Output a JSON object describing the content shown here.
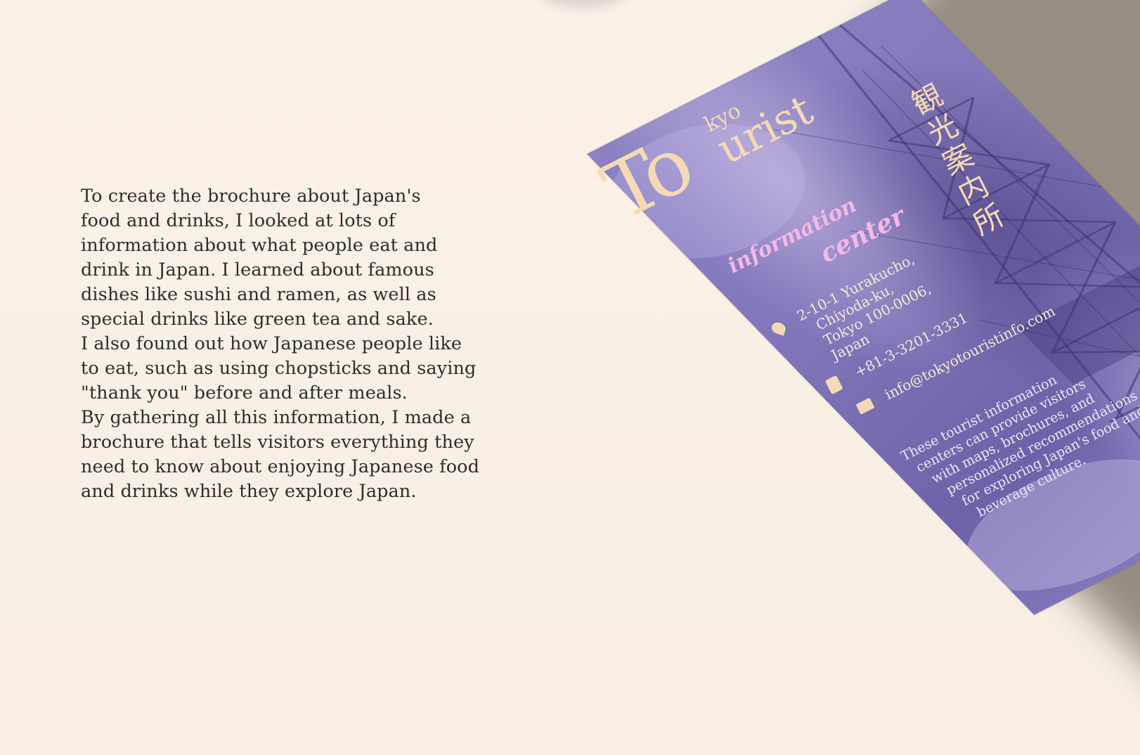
{
  "paragraph": [
    "To create the brochure about Japan's",
    "food and drinks, I looked at lots of",
    "information about what people eat and",
    "drink in Japan. I learned about famous",
    "dishes like sushi and ramen, as well as",
    "special drinks like green tea and sake.",
    "I also found out how Japanese people like",
    "to eat, such as using chopsticks and saying",
    "\"thank you\" before and after meals.",
    "By gathering all this information, I made a",
    "brochure that tells visitors everything they",
    "need to know about enjoying Japanese food",
    "and drinks while they explore Japan."
  ],
  "brochure": {
    "logo_to": "To",
    "logo_kyo": "kyo",
    "logo_urist": "urist",
    "script_information": "information",
    "script_center": "center",
    "kanji": "観光案内所",
    "address": [
      "2-10-1 Yurakucho,",
      "Chiyoda-ku,",
      "Tokyo 100-0006,",
      "Japan"
    ],
    "phone": "+81-3-3201-3331",
    "email": "info@tokyotouristinfo.com",
    "description": [
      "These tourist information",
      "centers can provide visitors",
      "with maps, brochures, and",
      "personalized recommendations",
      "for exploring Japan's food and",
      "beverage culture."
    ],
    "icons": {
      "address": "location-pin-icon",
      "phone": "phone-icon",
      "email": "envelope-icon"
    },
    "colors": {
      "brochure_bg": "#8c82c2",
      "logo": "#f5d9b4",
      "script": "#f2b9e6",
      "background": "#f8efe5",
      "body_text": "#2d2d2d"
    }
  }
}
